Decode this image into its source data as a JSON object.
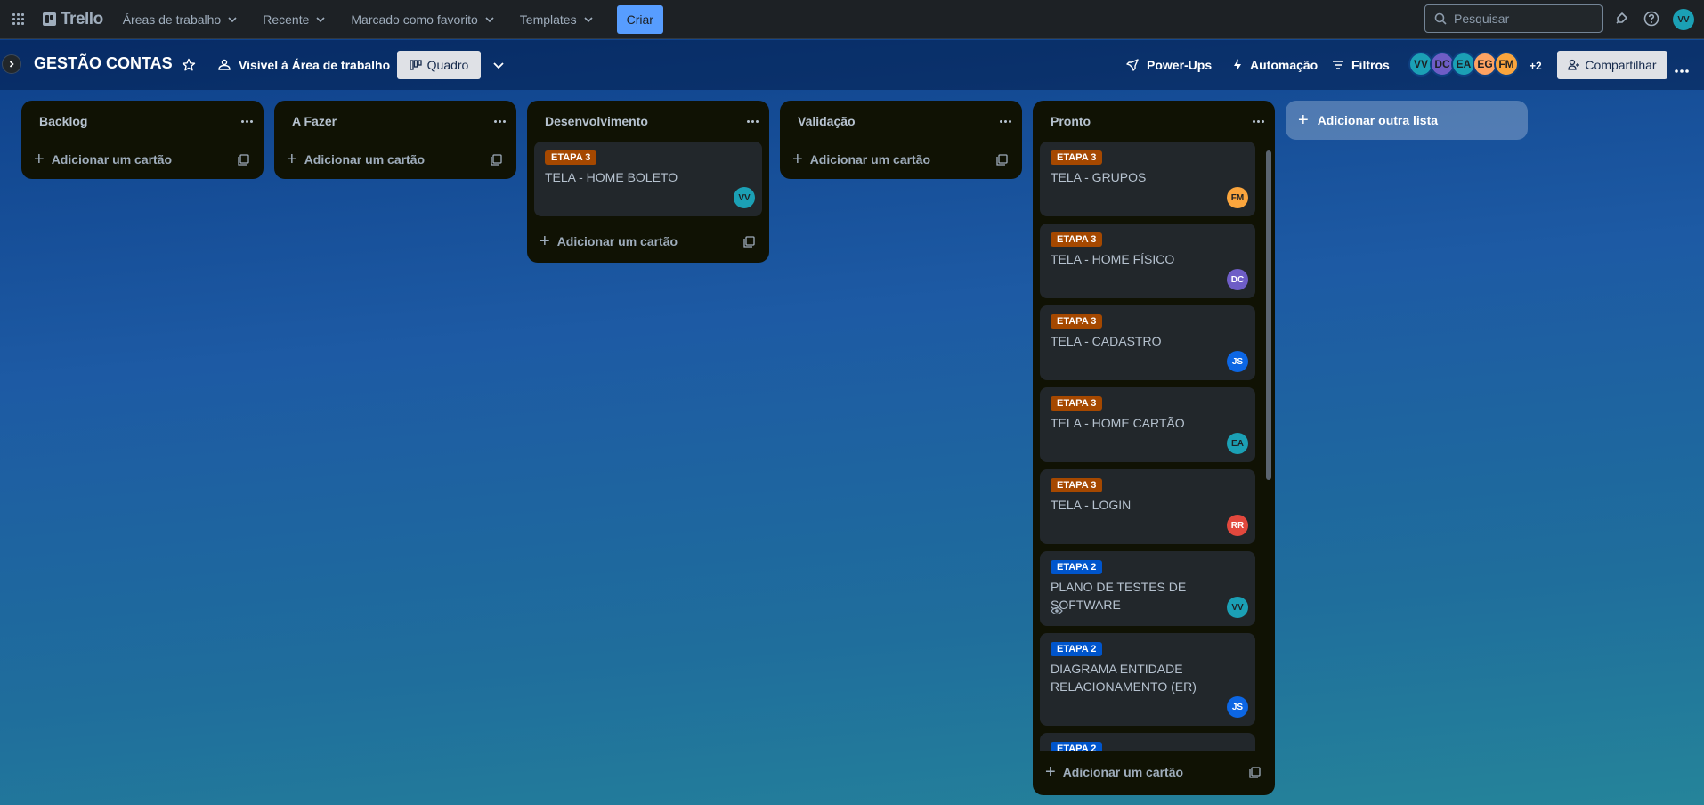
{
  "topbar": {
    "logo": "Trello",
    "nav": [
      {
        "label": "Áreas de trabalho"
      },
      {
        "label": "Recente"
      },
      {
        "label": "Marcado como favorito"
      },
      {
        "label": "Templates"
      }
    ],
    "create_label": "Criar",
    "search_placeholder": "Pesquisar",
    "user_initials": "VV"
  },
  "board": {
    "title": "GESTÃO CONTAS",
    "visibility_label": "Visível à Área de trabalho",
    "view_label": "Quadro",
    "powerups_label": "Power-Ups",
    "automation_label": "Automação",
    "filters_label": "Filtros",
    "members": [
      {
        "initials": "VV",
        "color": "#1ba0b5"
      },
      {
        "initials": "DC",
        "color": "#6e5dc6"
      },
      {
        "initials": "EA",
        "color": "#1ba0b5"
      },
      {
        "initials": "EG",
        "color": "#fea362"
      },
      {
        "initials": "FM",
        "color": "#faa53d"
      }
    ],
    "more_members": "+2",
    "share_label": "Compartilhar"
  },
  "lists": [
    {
      "title": "Backlog",
      "add_label": "Adicionar um cartão"
    },
    {
      "title": "A Fazer",
      "add_label": "Adicionar um cartão"
    },
    {
      "title": "Desenvolvimento",
      "add_label": "Adicionar um cartão",
      "cards": [
        {
          "label": "ETAPA 3",
          "title": "TELA - HOME BOLETO",
          "member": "VV"
        }
      ]
    },
    {
      "title": "Validação",
      "add_label": "Adicionar um cartão"
    },
    {
      "title": "Pronto",
      "add_label": "Adicionar um cartão",
      "cards": [
        {
          "label": "ETAPA 3",
          "title": "TELA - GRUPOS",
          "member": "FM"
        },
        {
          "label": "ETAPA 3",
          "title": "TELA - HOME FÍSICO",
          "member": "DC"
        },
        {
          "label": "ETAPA 3",
          "title": "TELA - CADASTRO",
          "member": "JS"
        },
        {
          "label": "ETAPA 3",
          "title": "TELA - HOME CARTÃO",
          "member": "EA"
        },
        {
          "label": "ETAPA 3",
          "title": "TELA - LOGIN",
          "member": "RR"
        },
        {
          "label": "ETAPA 2",
          "title": "PLANO DE TESTES DE SOFTWARE",
          "member": "VV"
        },
        {
          "label": "ETAPA 2",
          "title": "DIAGRAMA ENTIDADE RELACIONAMENTO (ER)",
          "member": "JS"
        },
        {
          "label": "ETAPA 2"
        }
      ]
    }
  ],
  "add_list_label": "Adicionar outra lista",
  "colors": {
    "etapa3": "#a54800",
    "etapa2": "#0055cc",
    "avatar_vv": "#1ba0b5",
    "avatar_fm": "#faa53d",
    "avatar_dc": "#6e5dc6",
    "avatar_js": "#0c66e4",
    "avatar_ea": "#1ba0b5",
    "avatar_rr": "#e2483d"
  }
}
